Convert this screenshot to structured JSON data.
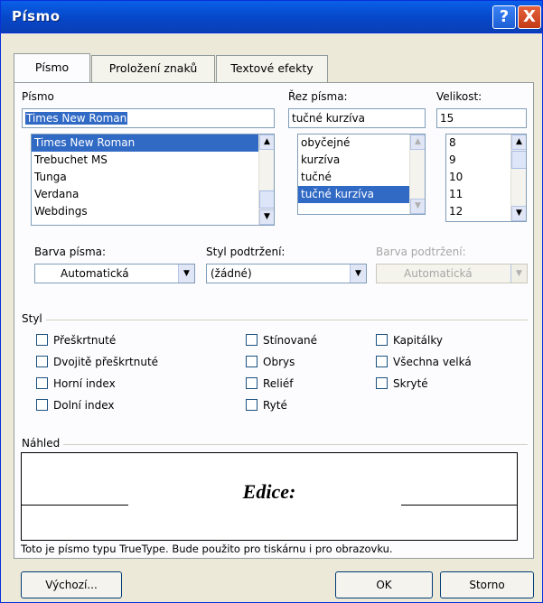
{
  "window": {
    "title": "Písmo",
    "help_label": "?",
    "close_label": "X"
  },
  "tabs": [
    {
      "label": "Písmo",
      "active": true
    },
    {
      "label": "Proložení znaků",
      "active": false
    },
    {
      "label": "Textové efekty",
      "active": false
    }
  ],
  "font": {
    "label": "Písmo",
    "value": "Times New Roman",
    "items": [
      "Times New Roman",
      "Trebuchet MS",
      "Tunga",
      "Verdana",
      "Webdings"
    ],
    "selected": "Times New Roman"
  },
  "style": {
    "label": "Řez písma:",
    "value": "tučné kurzíva",
    "items": [
      "obyčejné",
      "kurzíva",
      "tučné",
      "tučné kurzíva"
    ],
    "selected": "tučné kurzíva"
  },
  "size": {
    "label": "Velikost:",
    "value": "15",
    "items": [
      "8",
      "9",
      "10",
      "11",
      "12"
    ]
  },
  "font_color": {
    "label": "Barva písma:",
    "value": "Automatická"
  },
  "underline_style": {
    "label": "Styl podtržení:",
    "value": "(žádné)"
  },
  "underline_color": {
    "label": "Barva podtržení:",
    "value": "Automatická",
    "disabled": true
  },
  "effects": {
    "title": "Styl",
    "col1": [
      "Přeškrtnuté",
      "Dvojitě přeškrtnuté",
      "Horní index",
      "Dolní index"
    ],
    "col2": [
      "Stínované",
      "Obrys",
      "Reliéf",
      "Ryté"
    ],
    "col3": [
      "Kapitálky",
      "Všechna velká",
      "Skryté"
    ]
  },
  "preview": {
    "title": "Náhled",
    "sample": "Edice:",
    "note": "Toto je písmo typu TrueType. Bude použito pro tiskárnu i pro obrazovku."
  },
  "buttons": {
    "default": "Výchozí...",
    "ok": "OK",
    "cancel": "Storno"
  }
}
